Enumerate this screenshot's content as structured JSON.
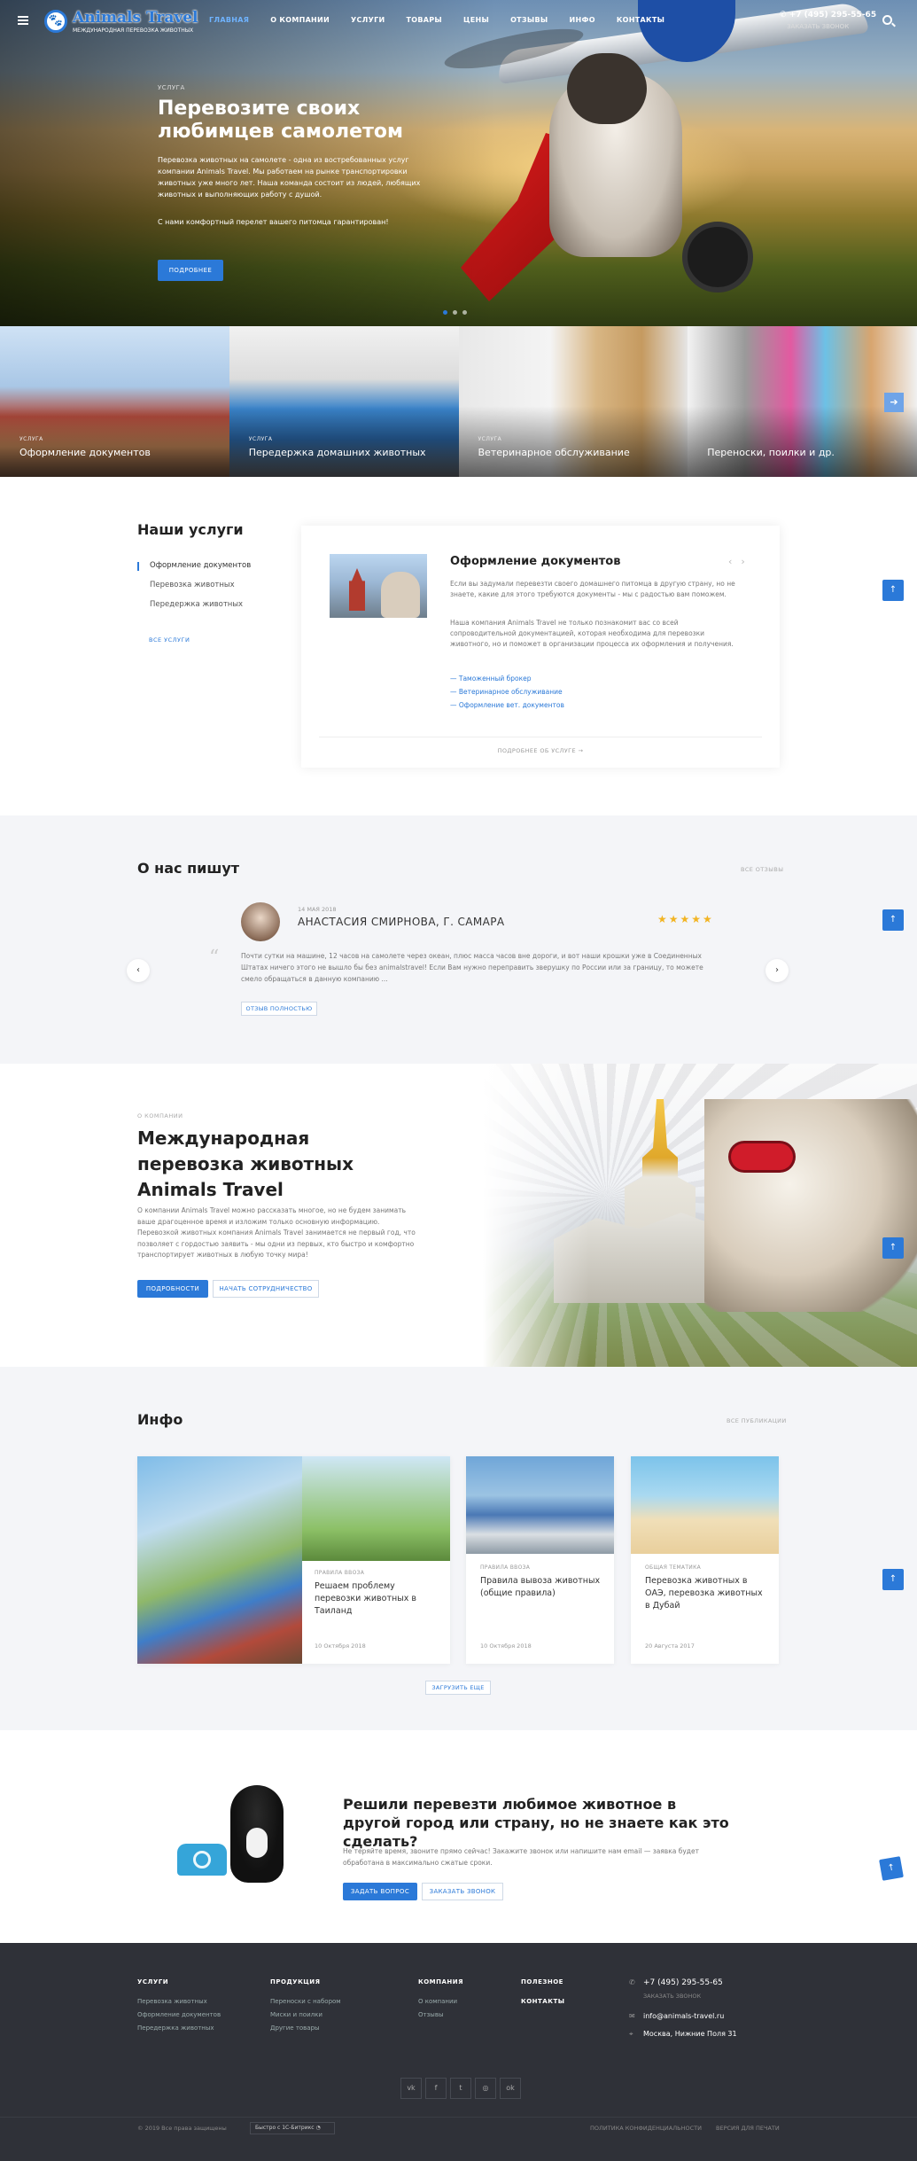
{
  "header": {
    "logo_name": "Animals Travel",
    "logo_tagline": "МЕЖДУНАРОДНАЯ ПЕРЕВОЗКА ЖИВОТНЫХ",
    "menu": [
      "ГЛАВНАЯ",
      "О КОМПАНИИ",
      "УСЛУГИ",
      "ТОВАРЫ",
      "ЦЕНЫ",
      "ОТЗЫВЫ",
      "ИНФО",
      "КОНТАКТЫ"
    ],
    "active_menu": "ГЛАВНАЯ",
    "phone": "+7 (495) 295-55-65",
    "callback": "ЗАКАЗАТЬ ЗВОНОК"
  },
  "hero": {
    "tag": "УСЛУГА",
    "title": "Перевозите своих любимцев самолетом",
    "text": "Перевозка животных на самолете - одна из востребованных услуг компании Animals Travel. Мы работаем на рынке транспортировки животных уже много лет. Наша команда состоит из людей, любящих животных и выполняющих работу с душой.",
    "text2": "С нами комфортный перелет вашего питомца гарантирован!",
    "button": "ПОДРОБНЕЕ"
  },
  "categories": [
    {
      "tag": "УСЛУГА",
      "label": "Оформление документов"
    },
    {
      "tag": "УСЛУГА",
      "label": "Передержка домашних животных"
    },
    {
      "tag": "УСЛУГА",
      "label": "Ветеринарное обслуживание"
    },
    {
      "tag": "",
      "label": "Переноски, поилки и др."
    }
  ],
  "services": {
    "title": "Наши услуги",
    "items": [
      "Оформление документов",
      "Перевозка животных",
      "Передержка животных"
    ],
    "all_link": "ВСЕ УСЛУГИ",
    "card_title": "Оформление документов",
    "card_p1": "Если вы задумали перевезти своего домашнего питомца в другую страну, но не знаете, какие для этого требуются документы - мы с радостью вам поможем.",
    "card_p2": "Наша компания Animals Travel не только познакомит вас со всей сопроводительной документацией, которая необходима для перевозки животного, но и поможет в организации процесса их оформления и получения.",
    "links": [
      "— Таможенный брокер",
      "— Ветеринарное обслуживание",
      "— Оформление вет. документов"
    ],
    "more": "ПОДРОБНЕЕ ОБ УСЛУГЕ"
  },
  "reviews": {
    "title": "О нас пишут",
    "all_link": "ВСЕ ОТЗЫВЫ",
    "date": "14 МАЯ 2018",
    "name": "АНАСТАСИЯ СМИРНОВА, Г. САМАРА",
    "stars": "★★★★★",
    "text": "Почти сутки на машине, 12 часов на самолете через океан, плюс масса часов вне дороги, и вот наши крошки уже в Соединенных Штатах ничего этого не вышло бы без animalstravel! Если Вам нужно переправить зверушку по России или за границу, то можете смело обращаться в данную компанию ...",
    "button": "ОТЗЫВ ПОЛНОСТЬЮ"
  },
  "about": {
    "tag": "О КОМПАНИИ",
    "title": "Международная перевозка животных Animals Travel",
    "text": "О компании Animals Travel можно рассказать многое, но не будем занимать ваше драгоценное время и изложим только основную информацию. Перевозкой животных компания Animals Travel занимается не первый год, что позволяет с гордостью заявить - мы одни из первых, кто быстро и комфортно транспортирует животных в любую точку мира!",
    "btn_more": "ПОДРОБНОСТИ",
    "btn_coop": "НАЧАТЬ СОТРУДНИЧЕСТВО"
  },
  "info": {
    "title": "Инфо",
    "all_link": "ВСЕ ПУБЛИКАЦИИ",
    "cards": [
      {
        "tag": "ПРАВИЛА ВВОЗА",
        "title": "Решаем проблему перевозки животных в Таиланд",
        "date": "10 Октября 2018"
      },
      {
        "tag": "ПРАВИЛА ВВОЗА",
        "title": "Правила вывоза животных (общие правила)",
        "date": "10 Октября 2018"
      },
      {
        "tag": "ОБЩАЯ ТЕМАТИКА",
        "title": "Перевозка животных в ОАЭ, перевозка животных в Дубай",
        "date": "20 Августа 2017"
      }
    ],
    "load_more": "ЗАГРУЗИТЬ ЕЩЕ"
  },
  "cta": {
    "title": "Решили перевезти любимое животное в другой город или страну, но не знаете как это сделать?",
    "text": "Не теряйте время, звоните прямо сейчас! Закажите звонок или напишите нам email — заявка будет обработана в максимально сжатые сроки.",
    "btn_ask": "ЗАДАТЬ ВОПРОС",
    "btn_call": "ЗАКАЗАТЬ ЗВОНОК"
  },
  "footer": {
    "cols": [
      {
        "title": "УСЛУГИ",
        "links": [
          "Перевозка животных",
          "Оформление документов",
          "Передержка животных"
        ]
      },
      {
        "title": "ПРОДУКЦИЯ",
        "links": [
          "Переноски с набором",
          "Миски и поилки",
          "Другие товары"
        ]
      },
      {
        "title": "КОМПАНИЯ",
        "links": [
          "О компании",
          "Отзывы"
        ]
      },
      {
        "title": "ПОЛЕЗНОЕ",
        "links": []
      },
      {
        "title": "КОНТАКТЫ",
        "links": []
      }
    ],
    "phone": "+7 (495) 295-55-65",
    "callback": "ЗАКАЗАТЬ ЗВОНОК",
    "email": "info@animals-travel.ru",
    "address": "Москва, Нижние Поля 31",
    "social": [
      "vk",
      "f",
      "t",
      "◎",
      "ok"
    ],
    "copyright": "© 2019 Все права защищены",
    "bitrix": "Быстро с 1С-Битрикс",
    "privacy": "ПОЛИТИКА КОНФИДЕНЦИАЛЬНОСТИ",
    "print": "ВЕРСИЯ ДЛЯ ПЕЧАТИ"
  },
  "colors": {
    "accent": "#2b79d8",
    "footer_bg": "#2f3138",
    "stars": "#f2b422"
  }
}
